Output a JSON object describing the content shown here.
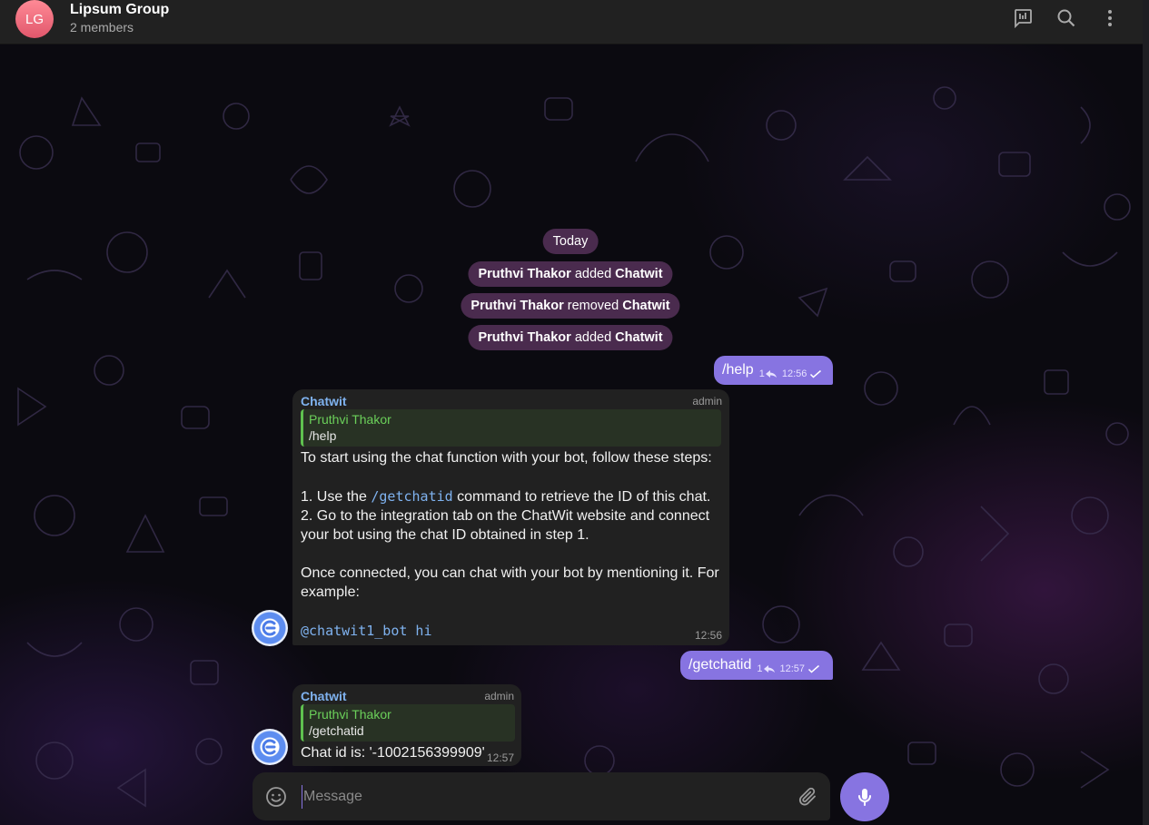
{
  "header": {
    "avatar_initials": "LG",
    "title": "Lipsum Group",
    "subtitle": "2 members",
    "icons": [
      "poll-icon",
      "search-icon",
      "more-vertical-icon"
    ]
  },
  "service": {
    "date": "Today",
    "events": [
      {
        "actor": "Pruthvi Thakor",
        "action": " added ",
        "target": "Chatwit"
      },
      {
        "actor": "Pruthvi Thakor",
        "action": " removed ",
        "target": "Chatwit"
      },
      {
        "actor": "Pruthvi Thakor",
        "action": " added ",
        "target": "Chatwit"
      }
    ]
  },
  "messages": {
    "out1": {
      "text": "/help",
      "replies": "1",
      "time": "12:56"
    },
    "in1": {
      "sender": "Chatwit",
      "role": "admin",
      "quote_name": "Pruthvi Thakor",
      "quote_text": "/help",
      "line1": "To start using the chat function with your bot, follow these steps:",
      "step1_pre": "1. Use the ",
      "step1_code": "/getchatid",
      "step1_post": " command to retrieve the ID of this chat.",
      "step2": "2. Go to the integration tab on the ChatWit website and connect your bot using the chat ID obtained in step 1.",
      "para3": "Once connected, you can chat with your bot by mentioning it. For example:",
      "example_code": "@chatwit1_bot hi",
      "time": "12:56"
    },
    "out2": {
      "text": "/getchatid",
      "replies": "1",
      "time": "12:57"
    },
    "in2": {
      "sender": "Chatwit",
      "role": "admin",
      "quote_name": "Pruthvi Thakor",
      "quote_text": "/getchatid",
      "text": "Chat id is: '-1002156399909'",
      "time": "12:57"
    }
  },
  "composer": {
    "placeholder": "Message"
  },
  "colors": {
    "accent": "#8774e1",
    "header_bg": "#212121",
    "pill_bg": "#4a2b4e",
    "sender": "#7fb2ef",
    "quote_green": "#6bd05a"
  }
}
